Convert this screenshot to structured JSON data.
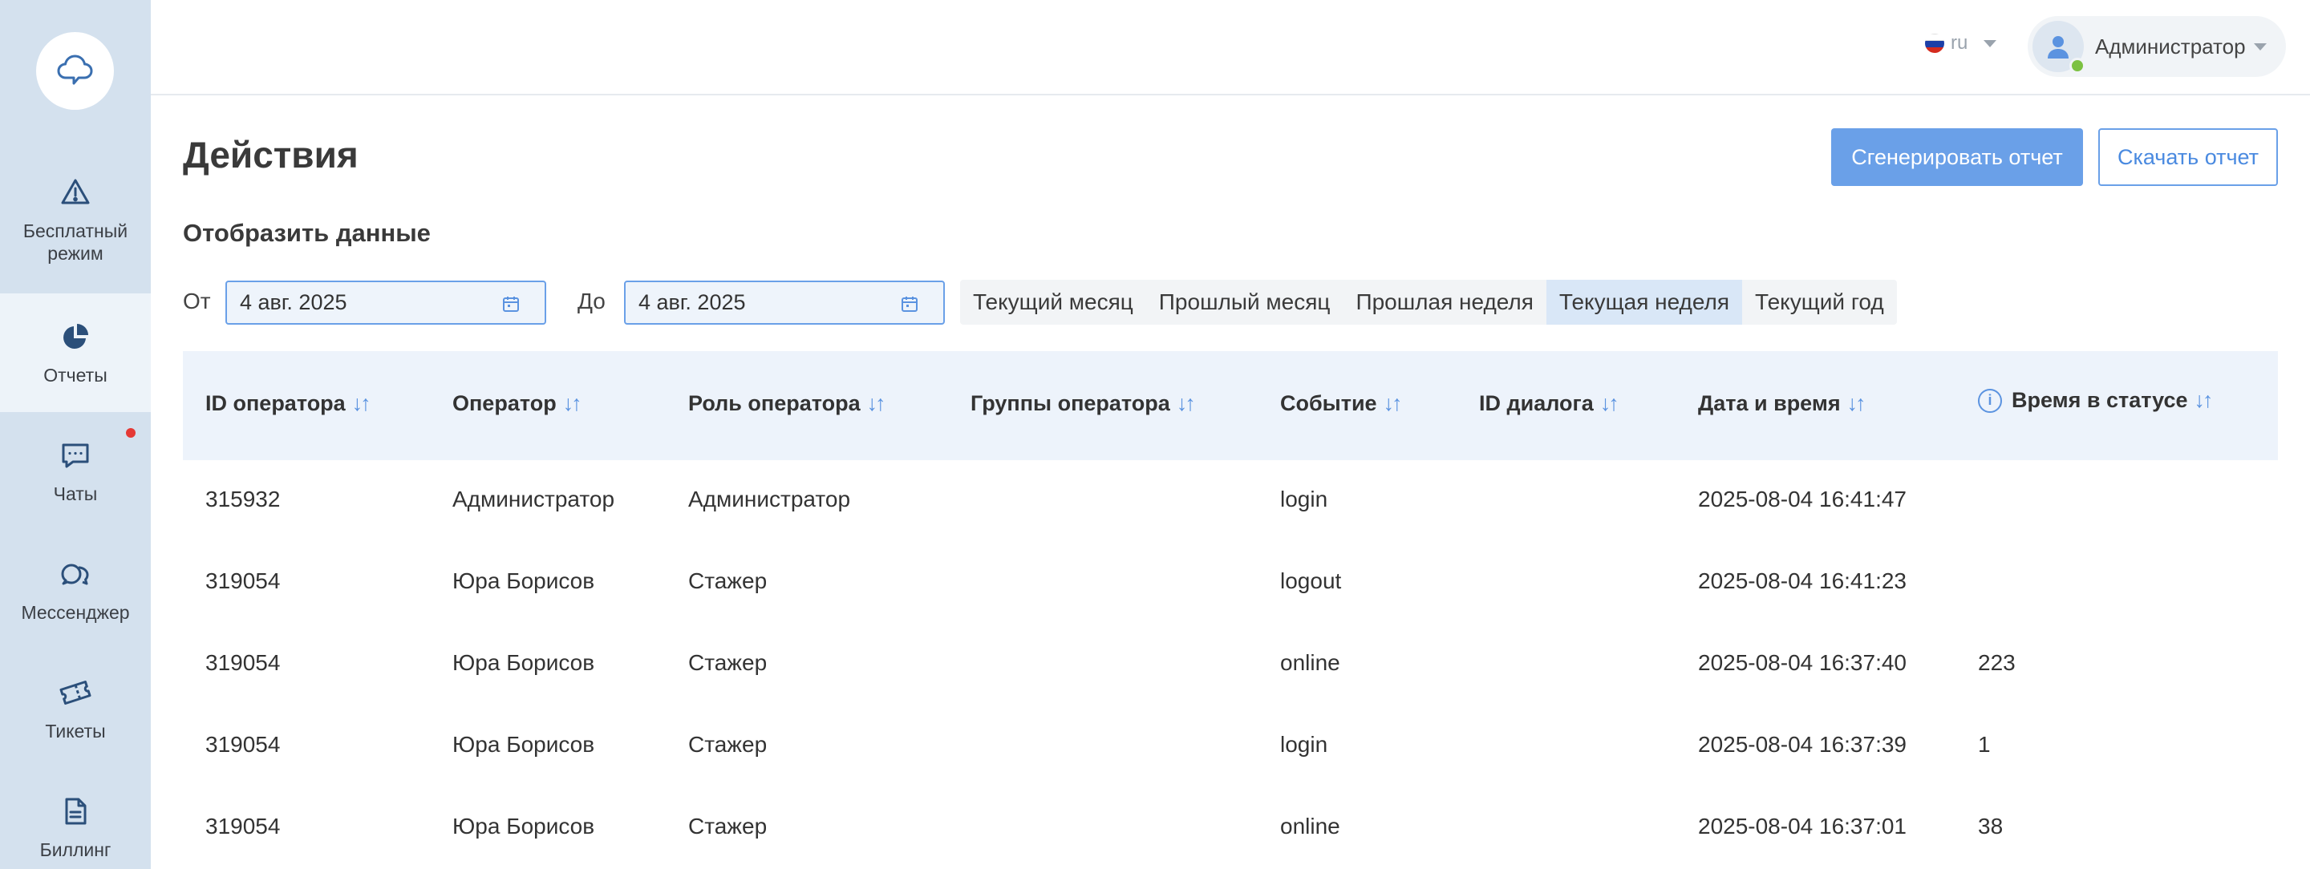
{
  "sidebar": {
    "items": [
      {
        "label_line1": "Бесплатный",
        "label_line2": "режим",
        "icon": "warning-icon"
      },
      {
        "label_line1": "Отчеты",
        "icon": "pie-chart-icon"
      },
      {
        "label_line1": "Чаты",
        "icon": "chat-icon"
      },
      {
        "label_line1": "Мессенджер",
        "icon": "messenger-icon"
      },
      {
        "label_line1": "Тикеты",
        "icon": "ticket-icon"
      },
      {
        "label_line1": "Биллинг",
        "icon": "document-icon"
      }
    ],
    "accent": "#e53935"
  },
  "header": {
    "language": "ru",
    "user_name": "Администратор",
    "status_color": "#7cc142"
  },
  "page": {
    "title": "Действия",
    "generate_button": "Сгенерировать отчет",
    "download_button": "Скачать отчет",
    "section_title": "Отобразить данные"
  },
  "filters": {
    "from_label": "От",
    "from_value": "4 авг. 2025",
    "to_label": "До",
    "to_value": "4 авг. 2025",
    "periods": [
      "Текущий месяц",
      "Прошлый месяц",
      "Прошлая неделя",
      "Текущая неделя",
      "Текущий год"
    ],
    "active_period": "Текущая неделя"
  },
  "table": {
    "columns": [
      "ID оператора",
      "Оператор",
      "Роль оператора",
      "Группы оператора",
      "Событие",
      "ID диалога",
      "Дата и время",
      "Время в статусе"
    ],
    "rows": [
      [
        "315932",
        "Администратор",
        "Администратор",
        "",
        "login",
        "",
        "2025-08-04 16:41:47",
        ""
      ],
      [
        "319054",
        "Юра Борисов",
        "Стажер",
        "",
        "logout",
        "",
        "2025-08-04 16:41:23",
        ""
      ],
      [
        "319054",
        "Юра Борисов",
        "Стажер",
        "",
        "online",
        "",
        "2025-08-04 16:37:40",
        "223"
      ],
      [
        "319054",
        "Юра Борисов",
        "Стажер",
        "",
        "login",
        "",
        "2025-08-04 16:37:39",
        "1"
      ],
      [
        "319054",
        "Юра Борисов",
        "Стажер",
        "",
        "online",
        "",
        "2025-08-04 16:37:01",
        "38"
      ]
    ]
  },
  "colors": {
    "primary": "#6aa0e8",
    "sidebar_bg": "#d4e1ee"
  }
}
